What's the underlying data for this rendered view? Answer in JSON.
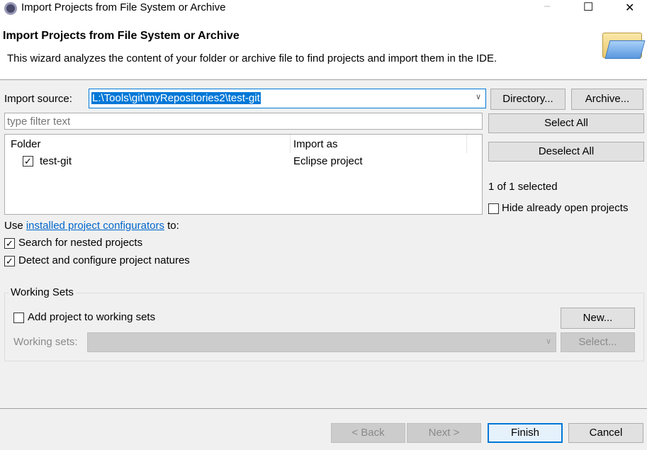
{
  "window": {
    "title": "Import Projects from File System or Archive",
    "minimize": "–",
    "maximize": "☐",
    "close": "✕"
  },
  "header": {
    "title": "Import Projects from File System or Archive",
    "description": "This wizard analyzes the content of your folder or archive file to find projects and import them in the IDE."
  },
  "source": {
    "label": "Import source:",
    "value": "L:\\Tools\\git\\myRepositories2\\test-git",
    "directory": "Directory...",
    "archive": "Archive..."
  },
  "filter": {
    "placeholder": "type filter text"
  },
  "table": {
    "columns": [
      "Folder",
      "Import as"
    ],
    "rows": [
      {
        "folder": "test-git",
        "import_as": "Eclipse project",
        "checked": true
      }
    ]
  },
  "side": {
    "select_all": "Select All",
    "deselect_all": "Deselect All",
    "status": "1 of 1 selected",
    "hide_open": "Hide already open projects"
  },
  "configurators": {
    "prefix": "Use ",
    "link": "installed project configurators",
    "suffix": " to:"
  },
  "options": {
    "nested": "Search for nested projects",
    "detect": "Detect and configure project natures"
  },
  "working_sets": {
    "title": "Working Sets",
    "add": "Add project to working sets",
    "new": "New...",
    "label": "Working sets:",
    "select": "Select..."
  },
  "footer": {
    "back": "< Back",
    "next": "Next >",
    "finish": "Finish",
    "cancel": "Cancel"
  },
  "colors": {
    "accent": "#0078d7",
    "link": "#0066cc"
  }
}
